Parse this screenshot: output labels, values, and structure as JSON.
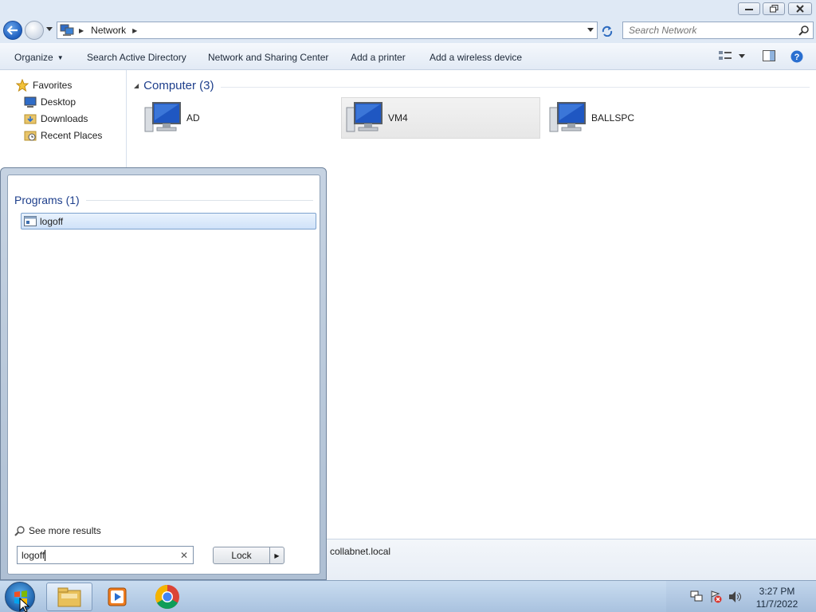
{
  "window": {
    "controls": [
      "minimize",
      "restore",
      "close"
    ]
  },
  "address": {
    "location": "Network",
    "search_placeholder": "Search Network"
  },
  "toolbar": {
    "organize": "Organize",
    "search_ad": "Search Active Directory",
    "network_sharing": "Network and Sharing Center",
    "add_printer": "Add a printer",
    "add_wireless": "Add a wireless device"
  },
  "nav": {
    "favorites": "Favorites",
    "items": [
      "Desktop",
      "Downloads",
      "Recent Places"
    ]
  },
  "content": {
    "group_label": "Computer (3)",
    "computers": [
      {
        "name": "AD",
        "selected": false
      },
      {
        "name": "VM4",
        "selected": true
      },
      {
        "name": "BALLSPC",
        "selected": false
      }
    ],
    "details_domain": "collabnet.local"
  },
  "start_menu": {
    "programs_header": "Programs (1)",
    "program": "logoff",
    "see_more": "See more results",
    "search_value": "logoff",
    "lock_label": "Lock"
  },
  "taskbar": {
    "time": "3:27 PM",
    "date": "11/7/2022"
  },
  "colors": {
    "accent_header": "#1e3f8c",
    "selection": "#cfe2f9",
    "taskbar": "#b7cde6"
  }
}
